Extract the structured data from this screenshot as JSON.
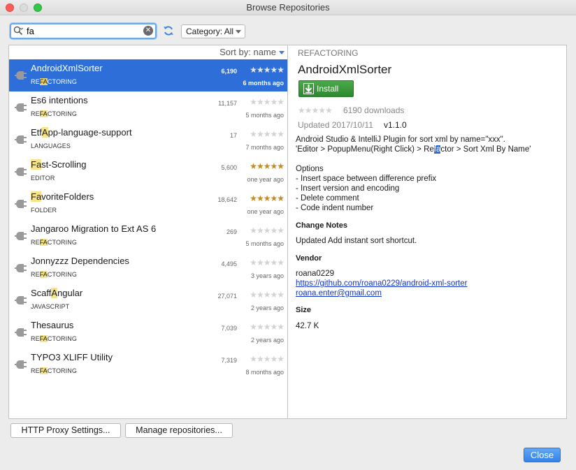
{
  "window": {
    "title": "Browse Repositories"
  },
  "search": {
    "value": "fa",
    "placeholder": ""
  },
  "category": {
    "label": "Category: All"
  },
  "sort": {
    "label": "Sort by: name"
  },
  "plugins": [
    {
      "pre": "AndroidXmlSorter",
      "hit": "",
      "post": "",
      "cat_pre": "RE",
      "cat_hit": "FA",
      "cat_post": "CTORING",
      "downloads": "6,190",
      "rating": 0,
      "age": "6 months ago",
      "selected": true
    },
    {
      "pre": "Es6 intentions",
      "hit": "",
      "post": "",
      "cat_pre": "RE",
      "cat_hit": "FA",
      "cat_post": "CTORING",
      "downloads": "11,157",
      "rating": 0,
      "age": "5 months ago",
      "selected": false
    },
    {
      "pre": "Etf",
      "hit": "A",
      "post": "pp-language-support",
      "cat_pre": "LANGUAGES",
      "cat_hit": "",
      "cat_post": "",
      "downloads": "17",
      "rating": 0,
      "age": "7 months ago",
      "selected": false
    },
    {
      "pre": "",
      "hit": "Fa",
      "post": "st-Scrolling",
      "cat_pre": "EDITOR",
      "cat_hit": "",
      "cat_post": "",
      "downloads": "5,600",
      "rating": 4.5,
      "age": "one year ago",
      "selected": false
    },
    {
      "pre": "",
      "hit": "Fa",
      "post": "voriteFolders",
      "cat_pre": "FOLDER",
      "cat_hit": "",
      "cat_post": "",
      "downloads": "18,642",
      "rating": 4.5,
      "age": "one year ago",
      "selected": false
    },
    {
      "pre": "Jangaroo Migration to Ext AS 6",
      "hit": "",
      "post": "",
      "cat_pre": "RE",
      "cat_hit": "FA",
      "cat_post": "CTORING",
      "downloads": "269",
      "rating": 0,
      "age": "5 months ago",
      "selected": false
    },
    {
      "pre": "Jonnyzzz Dependencies",
      "hit": "",
      "post": "",
      "cat_pre": "RE",
      "cat_hit": "FA",
      "cat_post": "CTORING",
      "downloads": "4,495",
      "rating": 0,
      "age": "3 years ago",
      "selected": false
    },
    {
      "pre": "Scaff",
      "hit": "A",
      "post": "ngular",
      "cat_pre": "JAVASCRIPT",
      "cat_hit": "",
      "cat_post": "",
      "downloads": "27,071",
      "rating": 0,
      "age": "2 years ago",
      "selected": false
    },
    {
      "pre": "Thesaurus",
      "hit": "",
      "post": "",
      "cat_pre": "RE",
      "cat_hit": "FA",
      "cat_post": "CTORING",
      "downloads": "7,039",
      "rating": 0,
      "age": "2 years ago",
      "selected": false
    },
    {
      "pre": "TYPO3 XLIFF Utility",
      "hit": "",
      "post": "",
      "cat_pre": "RE",
      "cat_hit": "FA",
      "cat_post": "CTORING",
      "downloads": "7,319",
      "rating": 0,
      "age": "8 months ago",
      "selected": false
    }
  ],
  "detail": {
    "category": "REFACTORING",
    "title": "AndroidXmlSorter",
    "install_label": "Install",
    "rating": 0,
    "downloads": "6190 downloads",
    "updated": "Updated 2017/10/11",
    "version": "v1.1.0",
    "desc_line1": "Android Studio & IntelliJ Plugin for sort xml by name=\"xxx\".",
    "desc_line2_pre": "'Editor > PopupMenu(Right Click) > Re",
    "desc_line2_hit": "fa",
    "desc_line2_post": "ctor > Sort Xml By Name'",
    "options_title": "Options",
    "options": [
      "- Insert space between difference prefix",
      "- Insert version and encoding",
      "- Delete comment",
      "- Code indent number"
    ],
    "change_notes_heading": "Change Notes",
    "change_notes": "Updated Add instant sort shortcut.",
    "vendor_heading": "Vendor",
    "vendor_name": "roana0229",
    "vendor_url": "https://github.com/roana0229/android-xml-sorter",
    "vendor_email": "roana.enter@gmail.com",
    "size_heading": "Size",
    "size": "42.7 K"
  },
  "buttons": {
    "proxy": "HTTP Proxy Settings...",
    "manage": "Manage repositories...",
    "close": "Close"
  },
  "colors": {
    "selection": "#2d6ed8",
    "install": "#3a9a3a",
    "star": "#c58a1e",
    "link": "#1133cc"
  }
}
